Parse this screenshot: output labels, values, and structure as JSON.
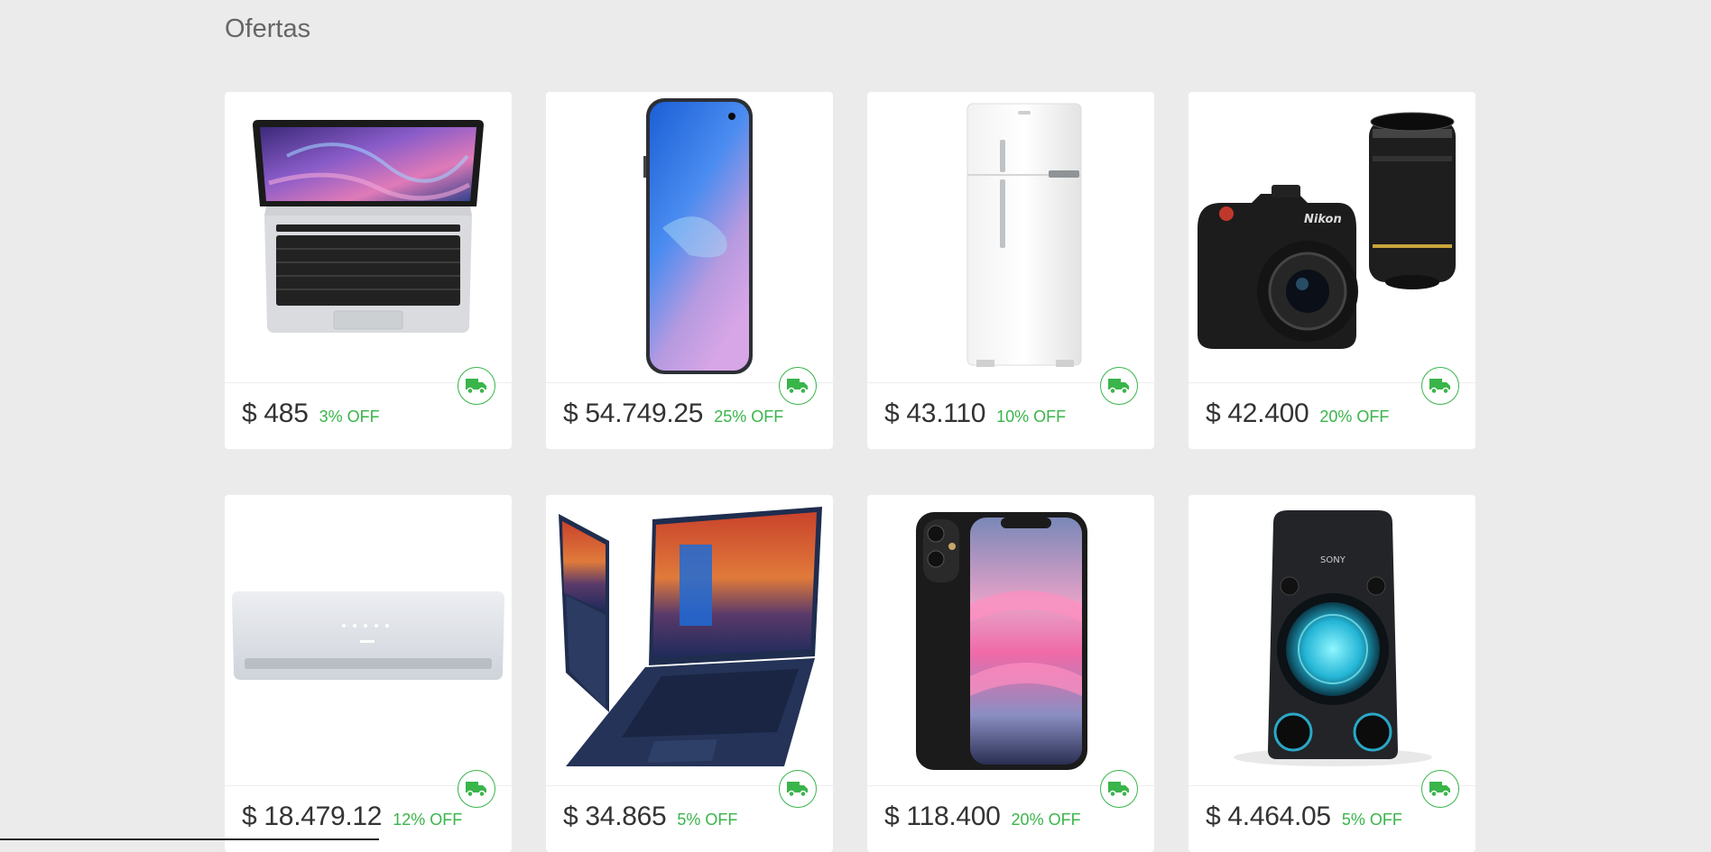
{
  "section": {
    "title": "Ofertas"
  },
  "colors": {
    "background": "#ebebeb",
    "card": "#ffffff",
    "accent_green": "#39b54a",
    "price_text": "#333333"
  },
  "products": [
    {
      "name": "laptop-silver",
      "price": "$ 485",
      "discount": "3% OFF",
      "shipping_icon": "truck-icon"
    },
    {
      "name": "smartphone-blue",
      "price": "$ 54.749.25",
      "discount": "25% OFF",
      "shipping_icon": "truck-icon"
    },
    {
      "name": "refrigerator",
      "price": "$ 43.110",
      "discount": "10% OFF",
      "shipping_icon": "truck-icon"
    },
    {
      "name": "camera",
      "price": "$ 42.400",
      "discount": "20% OFF",
      "shipping_icon": "truck-icon"
    },
    {
      "name": "air-conditioner",
      "price": "$ 18.479.12",
      "discount": "12% OFF",
      "shipping_icon": "truck-icon"
    },
    {
      "name": "laptop-blue",
      "price": "$ 34.865",
      "discount": "5% OFF",
      "shipping_icon": "truck-icon"
    },
    {
      "name": "iphone",
      "price": "$ 118.400",
      "discount": "20% OFF",
      "shipping_icon": "truck-icon"
    },
    {
      "name": "speaker",
      "price": "$ 4.464.05",
      "discount": "5% OFF",
      "shipping_icon": "truck-icon"
    }
  ]
}
